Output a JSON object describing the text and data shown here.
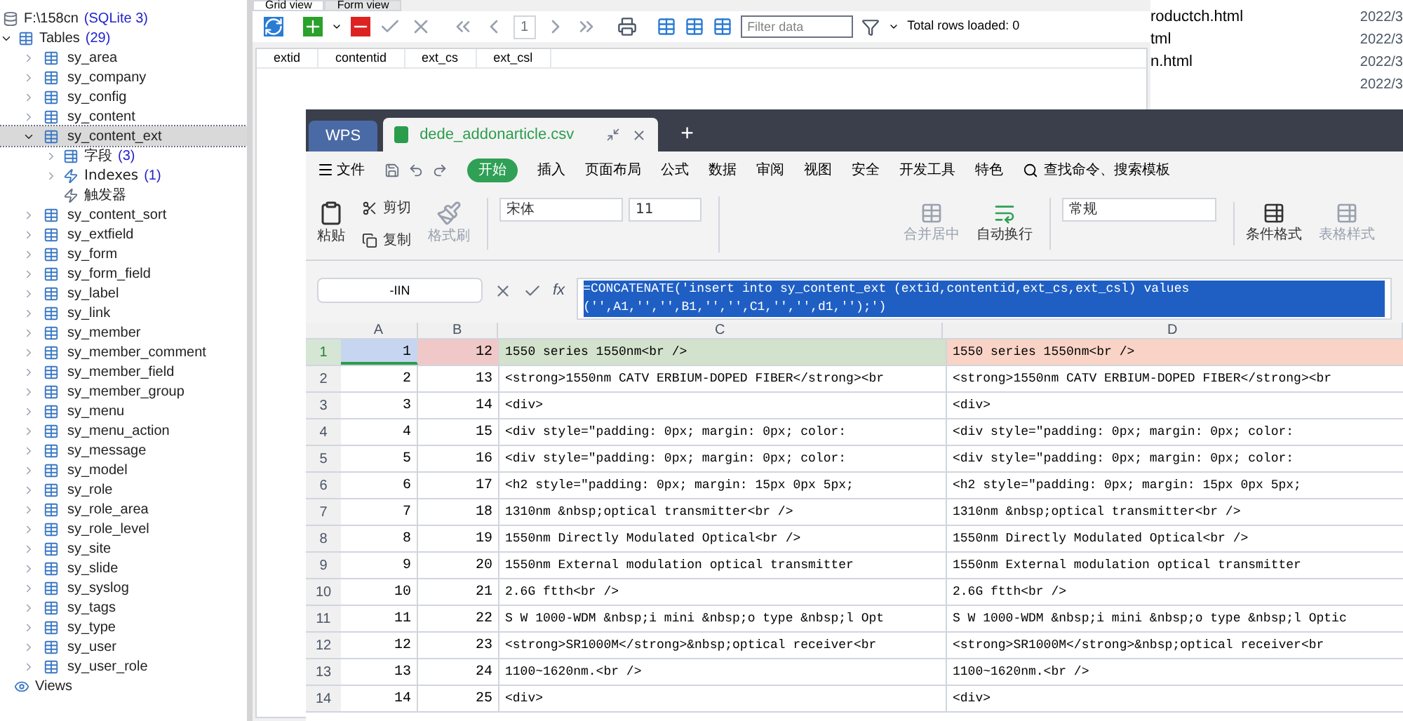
{
  "tree": {
    "database": "F:\\158cn",
    "engine": "(SQLite 3)",
    "tables_label": "Tables",
    "tables_count": "(29)",
    "items": [
      {
        "name": "sy_area",
        "expanded": false,
        "selected": false
      },
      {
        "name": "sy_company",
        "expanded": false,
        "selected": false
      },
      {
        "name": "sy_config",
        "expanded": false,
        "selected": false
      },
      {
        "name": "sy_content",
        "expanded": false,
        "selected": false
      },
      {
        "name": "sy_content_ext",
        "expanded": true,
        "selected": true,
        "children": [
          {
            "kind": "fields",
            "label": "字段",
            "count": "(3)"
          },
          {
            "kind": "indexes",
            "label": "Indexes",
            "count": "(1)"
          },
          {
            "kind": "triggers",
            "label": "触发器"
          }
        ]
      },
      {
        "name": "sy_content_sort",
        "expanded": false,
        "selected": false
      },
      {
        "name": "sy_extfield",
        "expanded": false,
        "selected": false
      },
      {
        "name": "sy_form",
        "expanded": false,
        "selected": false
      },
      {
        "name": "sy_form_field",
        "expanded": false,
        "selected": false
      },
      {
        "name": "sy_label",
        "expanded": false,
        "selected": false
      },
      {
        "name": "sy_link",
        "expanded": false,
        "selected": false
      },
      {
        "name": "sy_member",
        "expanded": false,
        "selected": false
      },
      {
        "name": "sy_member_comment",
        "expanded": false,
        "selected": false
      },
      {
        "name": "sy_member_field",
        "expanded": false,
        "selected": false
      },
      {
        "name": "sy_member_group",
        "expanded": false,
        "selected": false
      },
      {
        "name": "sy_menu",
        "expanded": false,
        "selected": false
      },
      {
        "name": "sy_menu_action",
        "expanded": false,
        "selected": false
      },
      {
        "name": "sy_message",
        "expanded": false,
        "selected": false
      },
      {
        "name": "sy_model",
        "expanded": false,
        "selected": false
      },
      {
        "name": "sy_role",
        "expanded": false,
        "selected": false
      },
      {
        "name": "sy_role_area",
        "expanded": false,
        "selected": false
      },
      {
        "name": "sy_role_level",
        "expanded": false,
        "selected": false
      },
      {
        "name": "sy_site",
        "expanded": false,
        "selected": false
      },
      {
        "name": "sy_slide",
        "expanded": false,
        "selected": false
      },
      {
        "name": "sy_syslog",
        "expanded": false,
        "selected": false
      },
      {
        "name": "sy_tags",
        "expanded": false,
        "selected": false
      },
      {
        "name": "sy_type",
        "expanded": false,
        "selected": false
      },
      {
        "name": "sy_user",
        "expanded": false,
        "selected": false
      },
      {
        "name": "sy_user_role",
        "expanded": false,
        "selected": false
      }
    ],
    "views_label": "Views"
  },
  "grid_panel": {
    "tabs": [
      {
        "label": "Grid view",
        "selected": true
      },
      {
        "label": "Form view",
        "selected": false
      }
    ],
    "page": "1",
    "filter_placeholder": "Filter data",
    "total_rows": "Total rows loaded: 0",
    "columns": [
      "extid",
      "contentid",
      "ext_cs",
      "ext_csl"
    ]
  },
  "file_list": [
    {
      "name": "roductch.html",
      "date": "2022/3"
    },
    {
      "name": "tml",
      "date": "2022/3"
    },
    {
      "name": "n.html",
      "date": "2022/3"
    },
    {
      "date": "2022/3"
    }
  ],
  "wps": {
    "app_tab": "WPS",
    "doc_tab": "dede_addonarticle.csv",
    "new_tab": "+",
    "menu": [
      {
        "label": "文件",
        "selected": false
      },
      {
        "label": "开始",
        "selected": true
      },
      {
        "label": "插入",
        "selected": false
      },
      {
        "label": "页面布局",
        "selected": false
      },
      {
        "label": "公式",
        "selected": false
      },
      {
        "label": "数据",
        "selected": false
      },
      {
        "label": "审阅",
        "selected": false
      },
      {
        "label": "视图",
        "selected": false
      },
      {
        "label": "安全",
        "selected": false
      },
      {
        "label": "开发工具",
        "selected": false
      },
      {
        "label": "特色",
        "selected": false
      }
    ],
    "search": "查找命令、搜索模板",
    "ribbon": {
      "paste": "粘贴",
      "cut": "剪切",
      "copy": "复制",
      "format_painter": "格式刷",
      "font": "宋体",
      "size": "11",
      "merge": "合并居中",
      "wrap": "自动换行",
      "number_format": "常规",
      "conditional": "条件格式",
      "table_style": "表格样式"
    },
    "name_box": "-IIN",
    "fx": "fx",
    "formula": "=CONCATENATE('insert into sy_content_ext (extid,contentid,ext_cs,ext_csl) values ('',A1,'','',B1,'','',C1,'','',d1,'');')",
    "columns": [
      "A",
      "B",
      "C",
      "D"
    ],
    "rows": [
      {
        "n": "1",
        "a": "1",
        "b": "12",
        "c": "1550 series 1550nm<br />",
        "d": "1550 series 1550nm<br />",
        "selected": true
      },
      {
        "n": "2",
        "a": "2",
        "b": "13",
        "c": "<strong>1550nm CATV ERBIUM-DOPED FIBER</strong><br",
        "d": "<strong>1550nm CATV ERBIUM-DOPED FIBER</strong><br",
        "selected": false
      },
      {
        "n": "3",
        "a": "3",
        "b": "14",
        "c": "<div>",
        "d": "<div>",
        "selected": false
      },
      {
        "n": "4",
        "a": "4",
        "b": "15",
        "c": "<div style=\"padding: 0px; margin: 0px; color:",
        "d": "<div style=\"padding: 0px; margin: 0px; color:",
        "selected": false
      },
      {
        "n": "5",
        "a": "5",
        "b": "16",
        "c": "<div style=\"padding: 0px; margin: 0px; color:",
        "d": "<div style=\"padding: 0px; margin: 0px; color:",
        "selected": false
      },
      {
        "n": "6",
        "a": "6",
        "b": "17",
        "c": "<h2 style=\"padding: 0px; margin: 15px 0px 5px;",
        "d": "<h2 style=\"padding: 0px; margin: 15px 0px 5px;",
        "selected": false
      },
      {
        "n": "7",
        "a": "7",
        "b": "18",
        "c": "1310nm &nbsp;optical transmitter<br />",
        "d": "1310nm &nbsp;optical transmitter<br />",
        "selected": false
      },
      {
        "n": "8",
        "a": "8",
        "b": "19",
        "c": "1550nm Directly Modulated Optical<br />",
        "d": "1550nm Directly Modulated Optical<br />",
        "selected": false
      },
      {
        "n": "9",
        "a": "9",
        "b": "20",
        "c": "1550nm External modulation optical transmitter",
        "d": "1550nm External modulation optical transmitter",
        "selected": false
      },
      {
        "n": "10",
        "a": "10",
        "b": "21",
        "c": "2.6G ftth<br />",
        "d": "2.6G ftth<br />",
        "selected": false
      },
      {
        "n": "11",
        "a": "11",
        "b": "22",
        "c": "S W 1000-WDM &nbsp;i mini &nbsp;o type &nbsp;l Opt",
        "d": "S W 1000-WDM &nbsp;i mini &nbsp;o type &nbsp;l Optic",
        "selected": false
      },
      {
        "n": "12",
        "a": "12",
        "b": "23",
        "c": "<strong>SR1000M</strong>&nbsp;optical receiver<br",
        "d": "<strong>SR1000M</strong>&nbsp;optical receiver<br",
        "selected": false
      },
      {
        "n": "13",
        "a": "13",
        "b": "24",
        "c": "1100~1620nm.<br />",
        "d": "1100~1620nm.<br />",
        "selected": false
      },
      {
        "n": "14",
        "a": "14",
        "b": "25",
        "c": "<div>",
        "d": "<div>",
        "selected": false
      }
    ]
  }
}
